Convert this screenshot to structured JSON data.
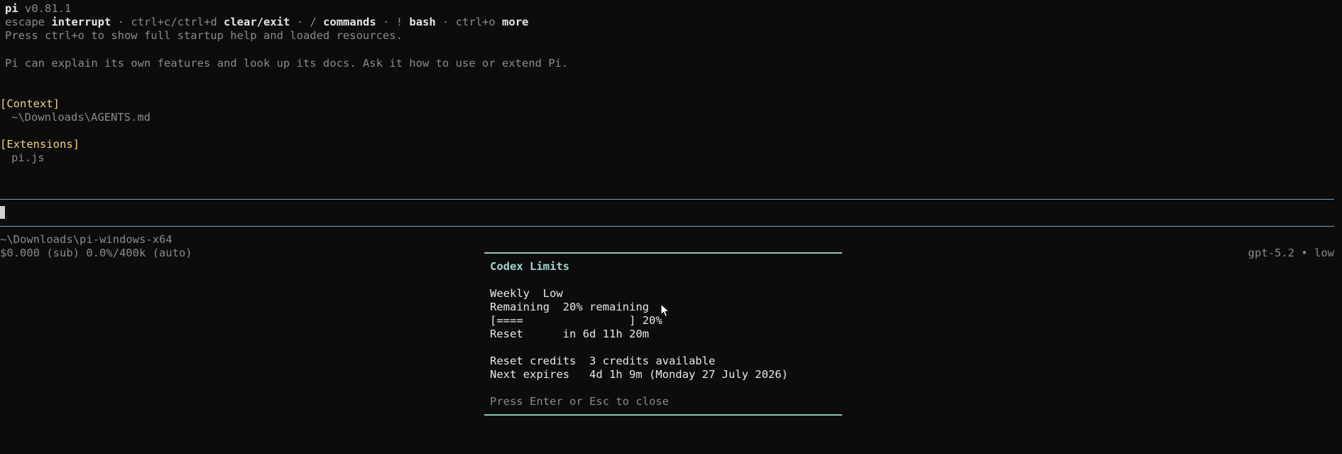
{
  "header": {
    "app_name": "pi",
    "version": "v0.81.1",
    "shortcuts": [
      {
        "key": "escape",
        "action": "interrupt"
      },
      {
        "key": "ctrl+c/ctrl+d",
        "action": "clear/exit"
      },
      {
        "key": "/",
        "action": "commands"
      },
      {
        "key": "!",
        "action": "bash"
      },
      {
        "key": "ctrl+o",
        "action": "more"
      }
    ],
    "separator": " · ",
    "startup_hint": "Press ctrl+o to show full startup help and loaded resources.",
    "tip": "Pi can explain its own features and look up its docs. Ask it how to use or extend Pi."
  },
  "context": {
    "heading": "[Context]",
    "items": [
      "~\\Downloads\\AGENTS.md"
    ]
  },
  "extensions": {
    "heading": "[Extensions]",
    "items": [
      "pi.js"
    ]
  },
  "prompt": {
    "value": ""
  },
  "status": {
    "cwd": "~\\Downloads\\pi-windows-x64",
    "usage": "$0.000 (sub) 0.0%/400k (auto)",
    "model": "gpt-5.2 • low"
  },
  "dialog": {
    "title": "Codex Limits",
    "weekly_label": "Weekly",
    "weekly_value": "Low",
    "remaining_label": "Remaining",
    "remaining_value": "20% remaining",
    "progress_bar": "[====                ]",
    "progress_percent_text": "20%",
    "progress_fraction": 0.2,
    "reset_label": "Reset",
    "reset_value": "in 6d 11h 20m",
    "credits_label": "Reset credits",
    "credits_value": "3 credits available",
    "expires_label": "Next expires",
    "expires_value": "4d 1h 9m (Monday 27 July 2026)",
    "hint": "Press Enter or Esc to close"
  },
  "colors": {
    "background": "#0c0c0c",
    "heading_yellow": "#f2d08a",
    "separator_blue": "#6f9fc4",
    "dialog_accent": "#8fc6b8",
    "dim_text": "#8a8a8a"
  }
}
